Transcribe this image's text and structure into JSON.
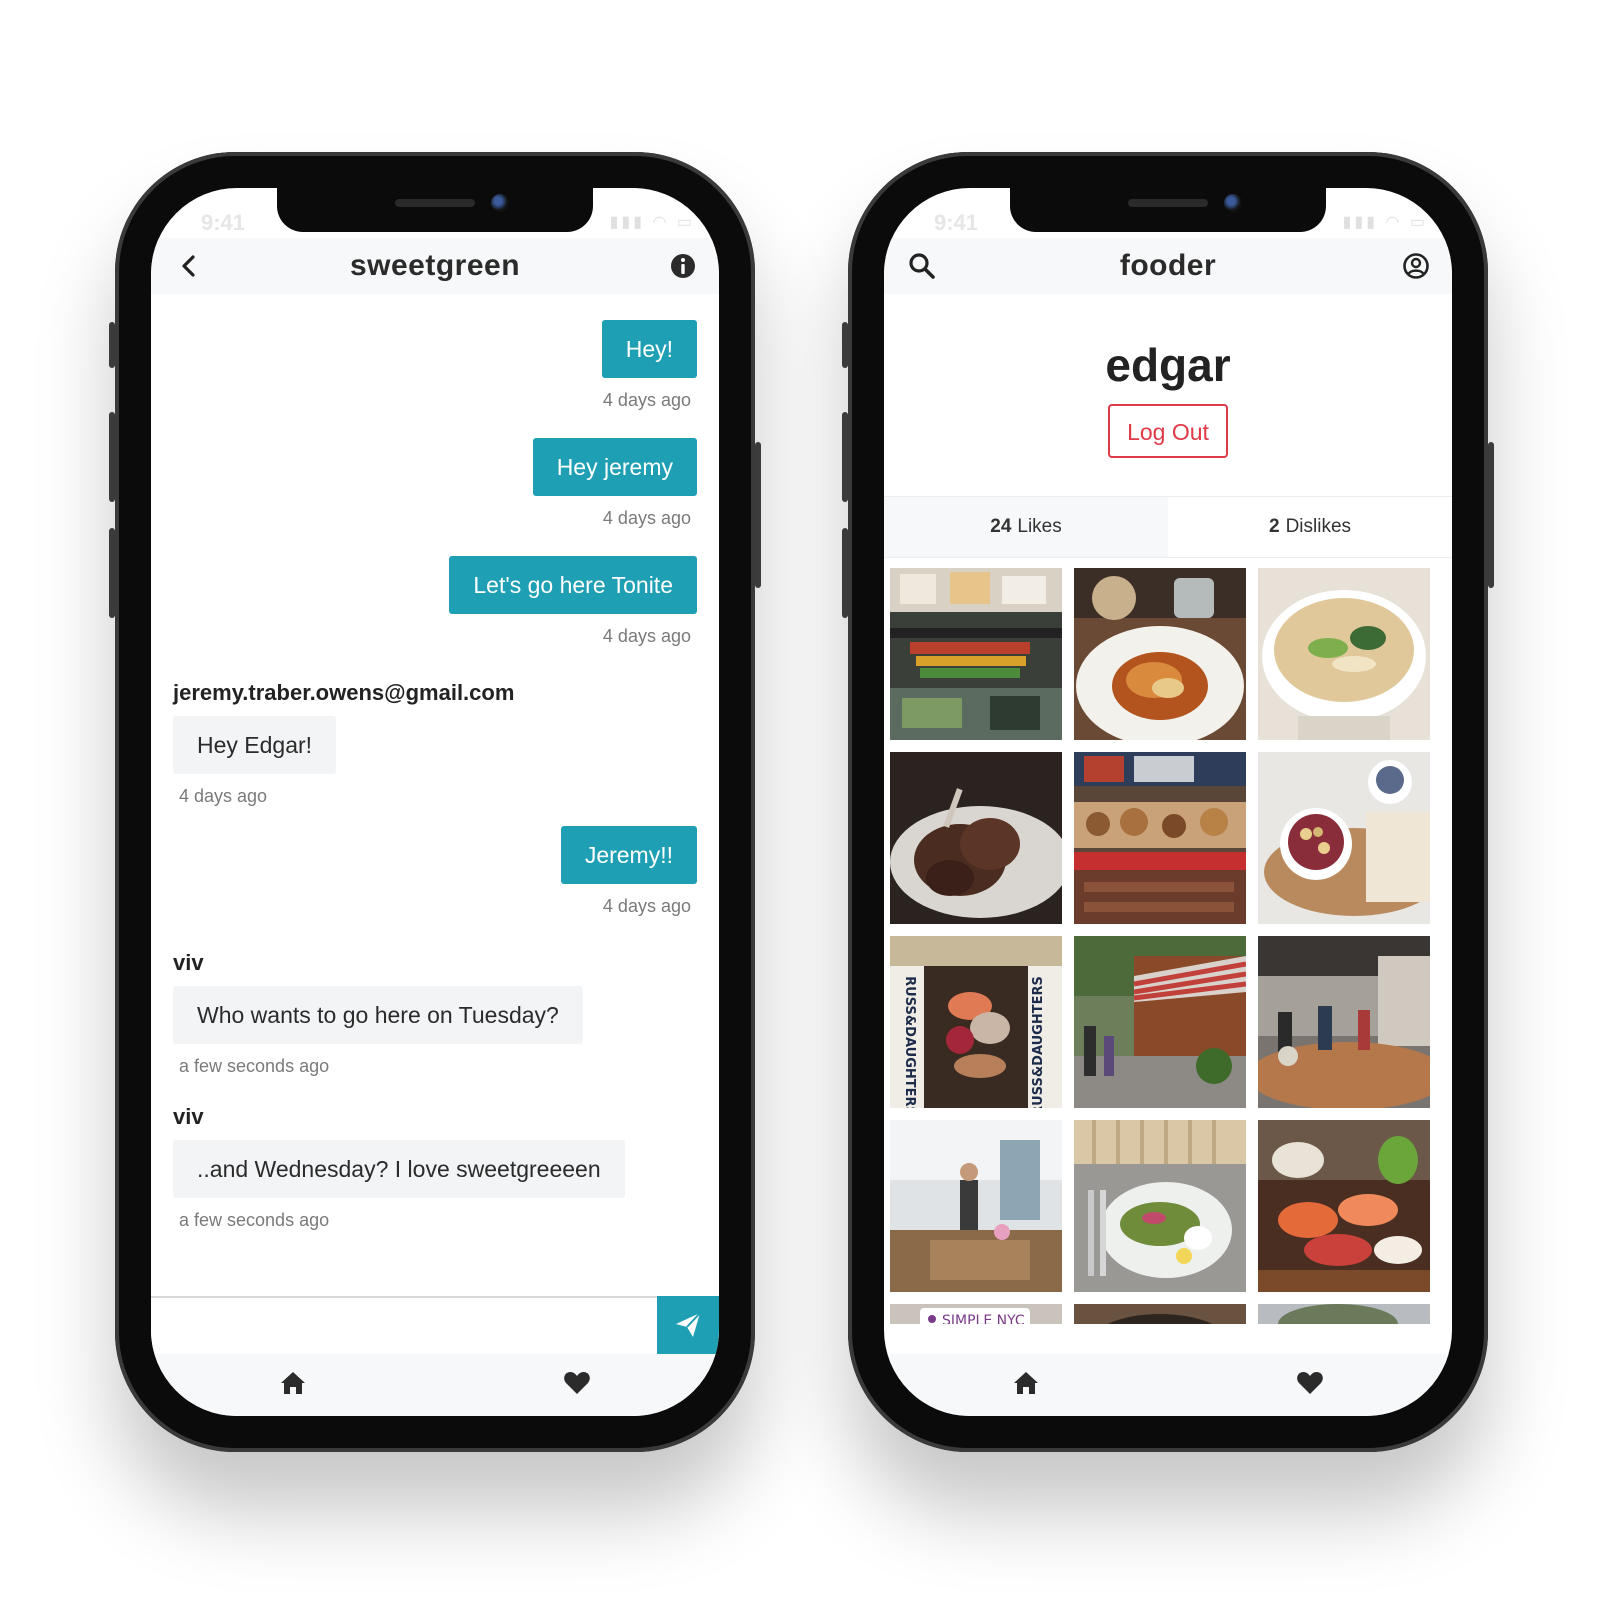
{
  "status": {
    "time": "9:41"
  },
  "chat": {
    "title": "sweetgreen",
    "messages": [
      {
        "direction": "out",
        "text": "Hey!",
        "time": "4 days ago"
      },
      {
        "direction": "out",
        "text": "Hey jeremy",
        "time": "4 days ago"
      },
      {
        "direction": "out",
        "text": "Let's go here Tonite",
        "time": "4 days ago"
      },
      {
        "direction": "in",
        "sender": "jeremy.traber.owens@gmail.com",
        "text": "Hey Edgar!",
        "time": "4 days ago"
      },
      {
        "direction": "out",
        "text": "Jeremy!!",
        "time": "4 days ago"
      },
      {
        "direction": "in",
        "sender": "viv",
        "text": "Who wants to go here on Tuesday?",
        "time": "a few seconds ago"
      },
      {
        "direction": "in",
        "sender": "viv",
        "text": "..and Wednesday? I love sweetgreeeen",
        "time": "a few seconds ago"
      }
    ],
    "composer": {
      "value": "",
      "placeholder": ""
    },
    "colors": {
      "accent": "#1f9fb4"
    },
    "icons": {
      "back": "chevron-left-icon",
      "info": "info-icon",
      "send": "paper-plane-icon"
    }
  },
  "profile": {
    "app_title": "fooder",
    "username": "edgar",
    "logout_label": "Log Out",
    "likes": {
      "count": "24",
      "label": "Likes"
    },
    "dislikes": {
      "count": "2",
      "label": "Dislikes"
    },
    "photo_labels": {
      "sign": "SIMPLE NYC",
      "russ": "RUSS&DAUGHTERS"
    },
    "colors": {
      "logout": "#e03a48"
    },
    "icons": {
      "search": "search-icon",
      "account": "user-circle-icon"
    }
  },
  "tabbar": {
    "icons": [
      "home-icon",
      "heart-icon"
    ]
  }
}
